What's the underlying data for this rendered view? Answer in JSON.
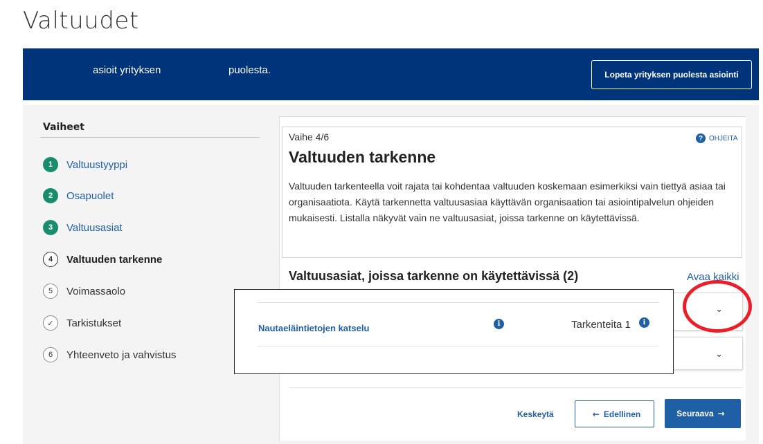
{
  "page": {
    "title": "Valtuudet"
  },
  "banner": {
    "text_left": "asioit yrityksen",
    "text_right": "puolesta.",
    "stop_button": "Lopeta yrityksen puolesta asiointi"
  },
  "steps": {
    "title": "Vaiheet",
    "items": [
      {
        "number": "1",
        "label": "Valtuustyyppi",
        "state": "done"
      },
      {
        "number": "2",
        "label": "Osapuolet",
        "state": "done"
      },
      {
        "number": "3",
        "label": "Valtuusasiat",
        "state": "done"
      },
      {
        "number": "4",
        "label": "Valtuuden tarkenne",
        "state": "current"
      },
      {
        "number": "5",
        "label": "Voimassaolo",
        "state": "todo"
      },
      {
        "number": "✓",
        "label": "Tarkistukset",
        "state": "todo"
      },
      {
        "number": "6",
        "label": "Yhteenveto ja vahvistus",
        "state": "todo"
      }
    ]
  },
  "main": {
    "step_indicator": "Vaihe 4/6",
    "help_label": "OHJEITA",
    "section_title": "Valtuuden tarkenne",
    "description": "Valtuuden tarkenteella voit rajata tai kohdentaa valtuuden koskemaan esimerkiksi vain tiettyä asiaa tai organisaatiota. Käytä tarkennetta valtuusasiaa käyttävän organisaation tai asiointipalvelun ohjeiden mukaisesti. Listalla näkyvät vain ne valtuusasiat, joissa tarkenne on käytettävissä.",
    "list_title": "Valtuusasiat, joissa tarkenne on käytettävissä (2)",
    "open_all": "Avaa kaikki",
    "item": {
      "name": "Nautaeläintietojen katselu",
      "refinements": "Tarkenteita 1"
    }
  },
  "icons": {
    "info": "i",
    "help": "?",
    "chevron": "⌄"
  },
  "buttons": {
    "cancel": "Keskeytä",
    "previous": "Edellinen",
    "next": "Seuraava",
    "prev_arrow": "←",
    "next_arrow": "→"
  },
  "colors": {
    "banner": "#00347a",
    "link": "#1f5fa6",
    "step_done": "#1a8c6e",
    "highlight_ring": "#e8202a"
  }
}
